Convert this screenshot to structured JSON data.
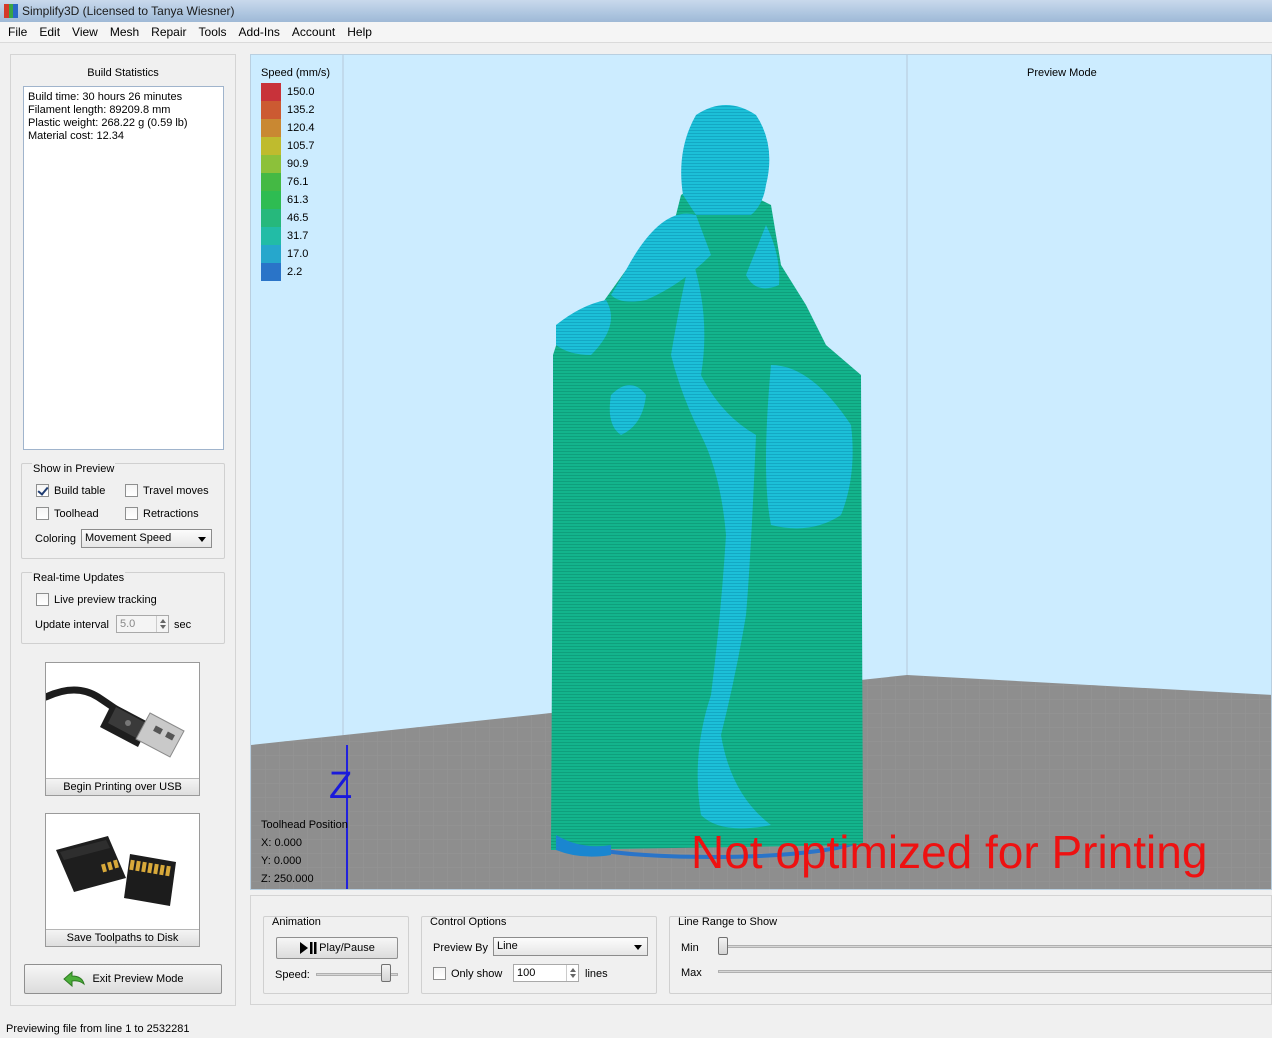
{
  "window": {
    "title": "Simplify3D (Licensed to Tanya Wiesner)"
  },
  "menu": [
    "File",
    "Edit",
    "View",
    "Mesh",
    "Repair",
    "Tools",
    "Add-Ins",
    "Account",
    "Help"
  ],
  "build_statistics": {
    "title": "Build Statistics",
    "lines": [
      "Build time: 30 hours 26 minutes",
      "Filament length: 89209.8 mm",
      "Plastic weight: 268.22 g (0.59 lb)",
      "Material cost: 12.34"
    ]
  },
  "show_in_preview": {
    "title": "Show in Preview",
    "build_table": {
      "label": "Build table",
      "checked": true
    },
    "travel_moves": {
      "label": "Travel moves",
      "checked": false
    },
    "toolhead": {
      "label": "Toolhead",
      "checked": false
    },
    "retractions": {
      "label": "Retractions",
      "checked": false
    },
    "coloring_label": "Coloring",
    "coloring_value": "Movement Speed"
  },
  "realtime_updates": {
    "title": "Real-time Updates",
    "live_tracking": {
      "label": "Live preview tracking",
      "checked": false
    },
    "interval_label": "Update interval",
    "interval_value": "5.0",
    "interval_unit": "sec"
  },
  "buttons": {
    "usb": "Begin Printing over USB",
    "save": "Save Toolpaths to Disk",
    "exit": "Exit Preview Mode"
  },
  "viewport": {
    "speed_legend_title": "Speed (mm/s)",
    "speed_legend": [
      {
        "value": "150.0",
        "color": "#c8323a"
      },
      {
        "value": "135.2",
        "color": "#cc5a32"
      },
      {
        "value": "120.4",
        "color": "#c98832"
      },
      {
        "value": "105.7",
        "color": "#bfbb2e"
      },
      {
        "value": "90.9",
        "color": "#8cc13a"
      },
      {
        "value": "76.1",
        "color": "#44b944"
      },
      {
        "value": "61.3",
        "color": "#2ebc52"
      },
      {
        "value": "46.5",
        "color": "#26b87c"
      },
      {
        "value": "31.7",
        "color": "#22bca6"
      },
      {
        "value": "17.0",
        "color": "#26a7cc"
      },
      {
        "value": "2.2",
        "color": "#2a74c8"
      }
    ],
    "preview_mode": "Preview Mode",
    "toolhead_position": {
      "title": "Toolhead Position",
      "x": "X: 0.000",
      "y": "Y: 0.000",
      "z": "Z: 250.000"
    },
    "axis_z": "Z",
    "watermark": "Not optimized for Printing"
  },
  "animation": {
    "title": "Animation",
    "play_label": "Play/Pause",
    "speed_label": "Speed:",
    "speed_fraction": 0.85
  },
  "control_options": {
    "title": "Control Options",
    "preview_by_label": "Preview By",
    "preview_by_value": "Line",
    "only_show": {
      "label": "Only show",
      "checked": false
    },
    "only_show_value": "100",
    "only_show_unit": "lines"
  },
  "line_range": {
    "title": "Line Range to Show",
    "min_label": "Min",
    "max_label": "Max"
  },
  "status": "Previewing file from line 1 to 2532281"
}
